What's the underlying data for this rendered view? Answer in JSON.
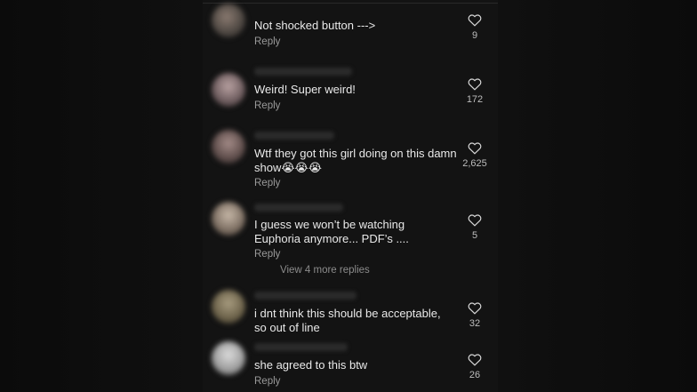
{
  "comments": [
    {
      "text": "Not shocked button --->",
      "reply_label": "Reply",
      "likes": "9"
    },
    {
      "text": "Weird! Super weird!",
      "reply_label": "Reply",
      "likes": "172"
    },
    {
      "text": "Wtf they got this girl doing on this damn show😭😭😭",
      "reply_label": "Reply",
      "likes": "2,625"
    },
    {
      "text": "I guess we won’t be watching Euphoria anymore... PDF’s ....",
      "reply_label": "Reply",
      "likes": "5",
      "more_replies": "View 4 more replies"
    },
    {
      "text": "i dnt think this should be acceptable, so out of line",
      "reply_label": "",
      "likes": "32"
    },
    {
      "text": "she agreed to this btw",
      "reply_label": "Reply",
      "likes": "26"
    }
  ],
  "icons": {
    "like": "heart-outline-icon"
  },
  "colors": {
    "background": "#131313",
    "text": "#e9e9e9",
    "muted": "#9a9a9a"
  }
}
